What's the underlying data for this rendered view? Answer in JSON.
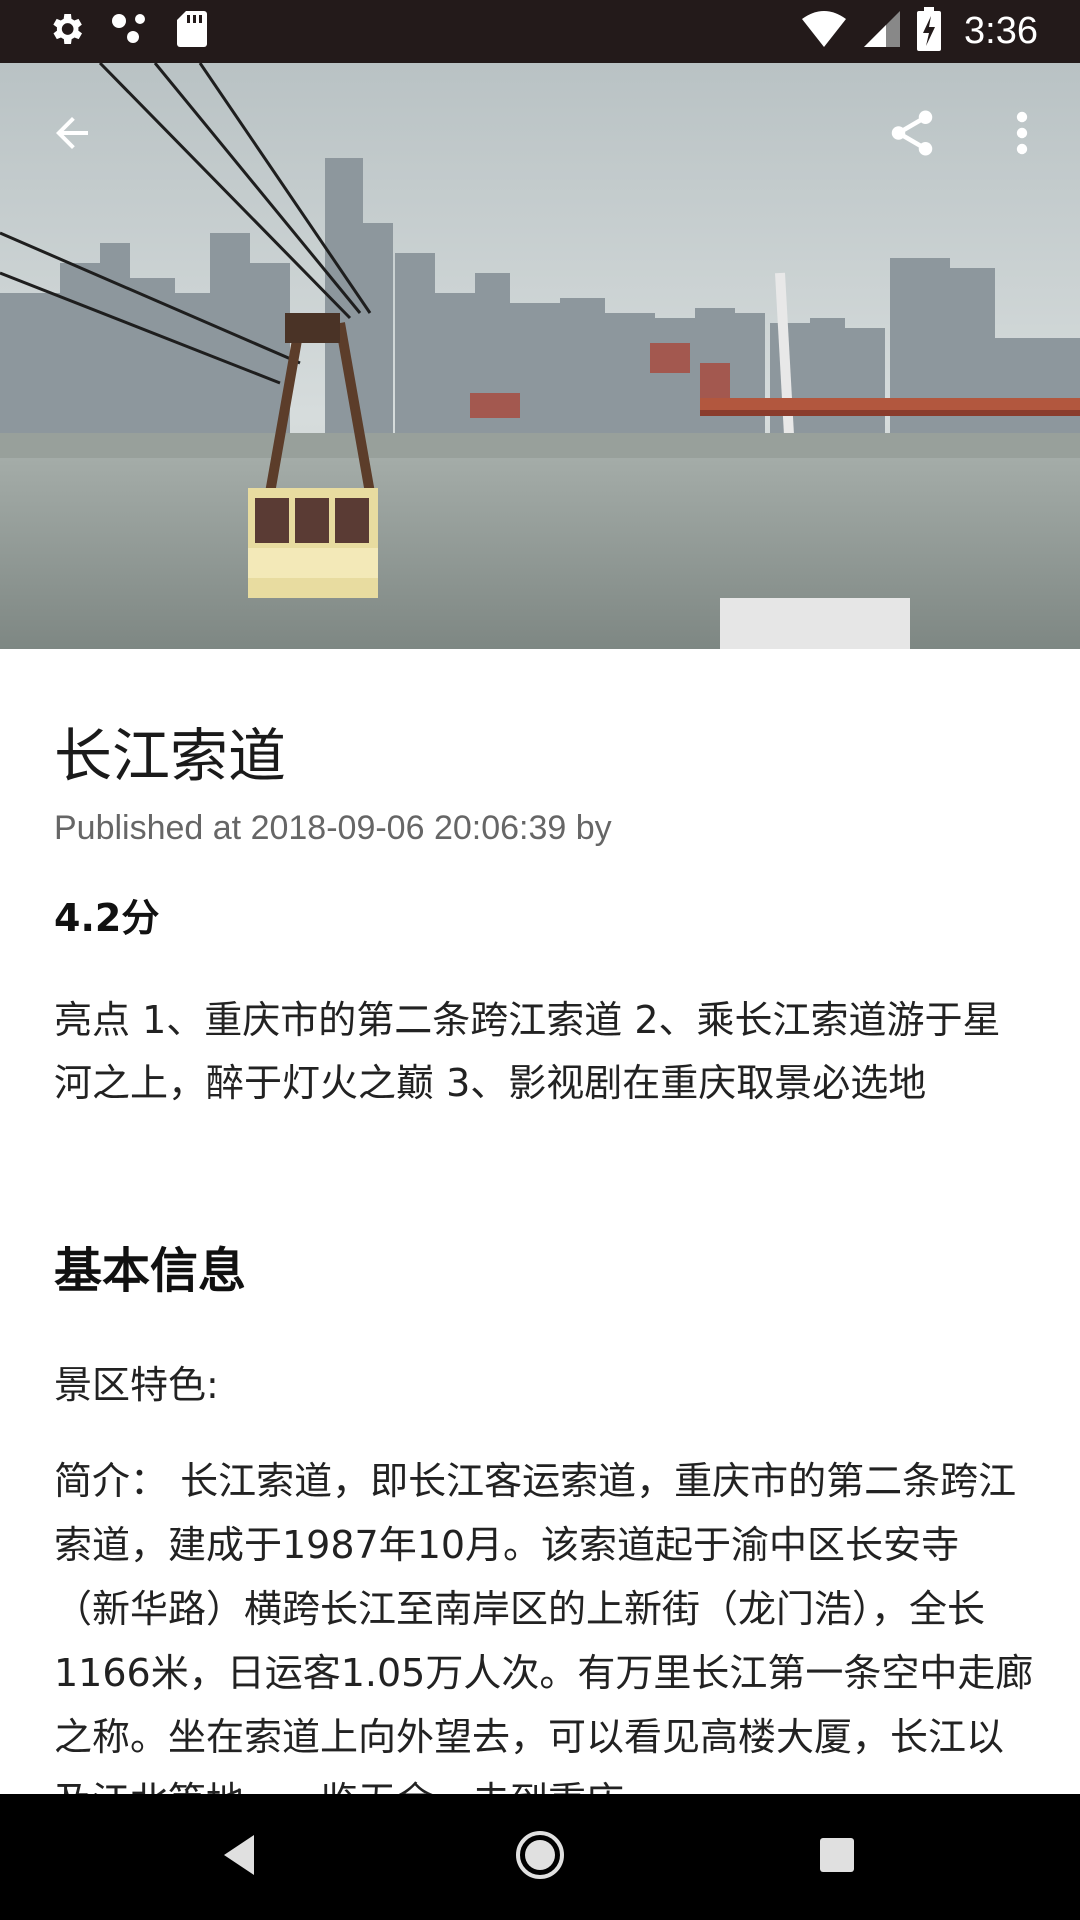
{
  "status_bar": {
    "time": "3:36",
    "icons": [
      "settings-icon",
      "dots-icon",
      "sd-card-icon",
      "wifi-icon",
      "signal-icon",
      "battery-icon"
    ]
  },
  "app_bar": {
    "icons": [
      "back-arrow-icon",
      "share-icon",
      "more-vert-icon"
    ]
  },
  "article": {
    "title": "长江索道",
    "published": "Published at 2018-09-06 20:06:39 by",
    "rating": "4.2分",
    "highlights": "亮点 1、重庆市的第二条跨江索道 2、乘长江索道游于星河之上，醉于灯火之巅 3、影视剧在重庆取景必选地",
    "section_title": "基本信息",
    "feature_label": "景区特色:",
    "intro": "简介：  长江索道，即长江客运索道，重庆市的第二条跨江索道，建成于1987年10月。该索道起于渝中区长安寺（新华路）横跨长江至南岸区的上新街（龙门浩），全长1166米，日运客1.05万人次。有万里长江第一条空中走廊之称。坐在索道上向外望去，可以看见高楼大厦，长江以及江北等地，一览无余，去到重庆"
  },
  "nav_bar": {
    "icons": [
      "back-triangle-icon",
      "home-circle-icon",
      "recents-square-icon"
    ]
  },
  "colors": {
    "status_bar_bg": "#231a1a",
    "nav_bar_bg": "#000000",
    "cable_car": "#e8dca0"
  }
}
